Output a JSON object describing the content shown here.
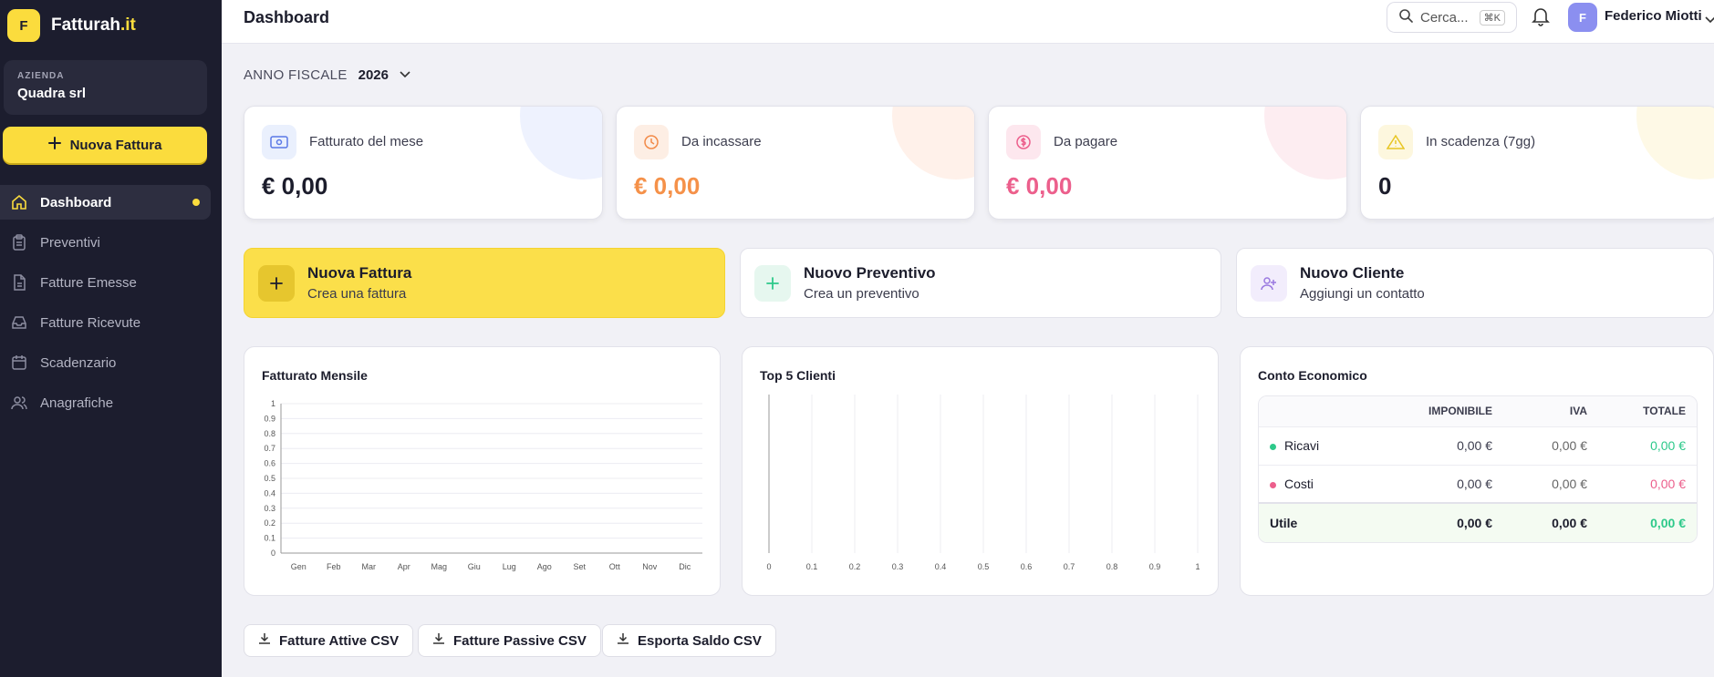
{
  "brand": {
    "logo_letter": "F",
    "name": "Fatturah",
    "tld": ".it"
  },
  "company": {
    "label": "AZIENDA",
    "name": "Quadra srl"
  },
  "sidebar": {
    "new_invoice_label": "Nuova Fattura",
    "items": [
      {
        "label": "Dashboard",
        "icon": "home-icon",
        "active": true
      },
      {
        "label": "Preventivi",
        "icon": "clipboard-icon"
      },
      {
        "label": "Fatture Emesse",
        "icon": "document-icon"
      },
      {
        "label": "Fatture Ricevute",
        "icon": "inbox-icon"
      },
      {
        "label": "Scadenzario",
        "icon": "calendar-icon"
      },
      {
        "label": "Anagrafiche",
        "icon": "users-icon"
      }
    ]
  },
  "header": {
    "title": "Dashboard",
    "search_placeholder": "Cerca...",
    "search_shortcut": "⌘K",
    "avatar_letter": "F",
    "user_name": "Federico Miotti"
  },
  "year": {
    "label": "ANNO FISCALE",
    "value": "2026"
  },
  "stats": [
    {
      "label": "Fatturato del mese",
      "value": "€ 0,00",
      "icon": "money-icon",
      "color": "#1c1d2c"
    },
    {
      "label": "Da incassare",
      "value": "€ 0,00",
      "icon": "clock-icon",
      "color": "#f59149"
    },
    {
      "label": "Da pagare",
      "value": "€ 0,00",
      "icon": "dollar-icon",
      "color": "#ec5f8c"
    },
    {
      "label": "In scadenza (7gg)",
      "value": "0",
      "icon": "warning-icon",
      "color": "#1c1d2c"
    }
  ],
  "quick_actions": [
    {
      "title": "Nuova Fattura",
      "subtitle": "Crea una fattura",
      "icon": "plus-icon"
    },
    {
      "title": "Nuovo Preventivo",
      "subtitle": "Crea un preventivo",
      "icon": "plus-icon"
    },
    {
      "title": "Nuovo Cliente",
      "subtitle": "Aggiungi un contatto",
      "icon": "user-plus-icon"
    }
  ],
  "panels": {
    "monthly_title": "Fatturato Mensile",
    "top_clients_title": "Top 5 Clienti",
    "income_title": "Conto Economico"
  },
  "chart_data": [
    {
      "type": "line",
      "title": "Fatturato Mensile",
      "categories": [
        "Gen",
        "Feb",
        "Mar",
        "Apr",
        "Mag",
        "Giu",
        "Lug",
        "Ago",
        "Set",
        "Ott",
        "Nov",
        "Dic"
      ],
      "series": [],
      "ylim": [
        0,
        1
      ],
      "yticks": [
        "0",
        "0.1",
        "0.2",
        "0.3",
        "0.4",
        "0.5",
        "0.6",
        "0.7",
        "0.8",
        "0.9",
        "1"
      ],
      "grid": true
    },
    {
      "type": "bar",
      "title": "Top 5 Clienti",
      "orientation": "horizontal",
      "categories": [],
      "series": [],
      "xlim": [
        0,
        1
      ],
      "xticks": [
        "0",
        "0.1",
        "0.2",
        "0.3",
        "0.4",
        "0.5",
        "0.6",
        "0.7",
        "0.8",
        "0.9",
        "1"
      ],
      "grid": true
    }
  ],
  "income_statement": {
    "columns": [
      "IMPONIBILE",
      "IVA",
      "TOTALE"
    ],
    "rows": [
      {
        "label": "Ricavi",
        "imponibile": "0,00 €",
        "iva": "0,00 €",
        "totale": "0,00 €",
        "color": "#2dc98a"
      },
      {
        "label": "Costi",
        "imponibile": "0,00 €",
        "iva": "0,00 €",
        "totale": "0,00 €",
        "color": "#ec5f8c"
      }
    ],
    "total": {
      "label": "Utile",
      "imponibile": "0,00 €",
      "iva": "0,00 €",
      "totale": "0,00 €"
    }
  },
  "exports": [
    {
      "label": "Fatture Attive CSV"
    },
    {
      "label": "Fatture Passive CSV"
    },
    {
      "label": "Esporta Saldo CSV"
    }
  ]
}
